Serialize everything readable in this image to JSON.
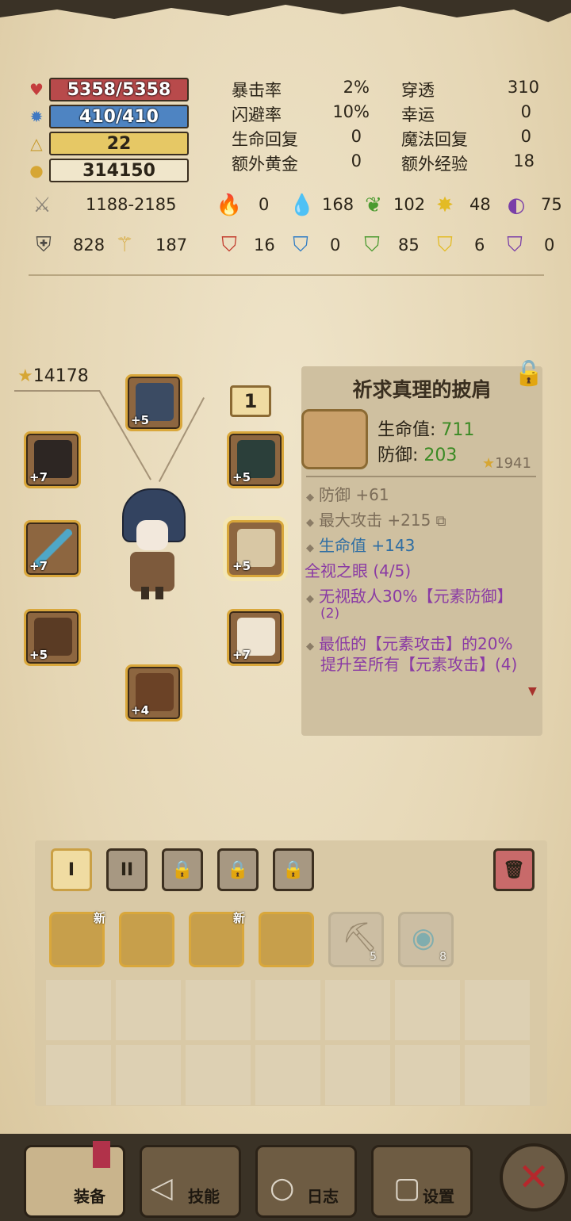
{
  "stats_bars": {
    "hp": "5358/5358",
    "mp": "410/410",
    "level": "22",
    "gold": "314150"
  },
  "stats_table": [
    {
      "label": "暴击率",
      "value": "2%"
    },
    {
      "label": "闪避率",
      "value": "10%"
    },
    {
      "label": "生命回复",
      "value": "0"
    },
    {
      "label": "额外黄金",
      "value": "0"
    },
    {
      "label": "穿透",
      "value": "310"
    },
    {
      "label": "幸运",
      "value": "0"
    },
    {
      "label": "魔法回复",
      "value": "0"
    },
    {
      "label": "额外经验",
      "value": "18"
    }
  ],
  "attack_row": {
    "damage": "1188-2185",
    "fire_atk": "0",
    "water_atk": "168",
    "nature_atk": "102",
    "light_atk": "48",
    "dark_atk": "75"
  },
  "defense_row": {
    "armor": "828",
    "magic": "187",
    "fire_def": "16",
    "water_def": "0",
    "nature_def": "85",
    "light_def": "6",
    "dark_def": "0"
  },
  "equipment": {
    "power_score": "14178",
    "page_number": "1",
    "slots": [
      {
        "name": "helmet",
        "plus": "+5"
      },
      {
        "name": "mask",
        "plus": "+7"
      },
      {
        "name": "sword",
        "plus": "+7"
      },
      {
        "name": "gloves",
        "plus": "+5"
      },
      {
        "name": "boots",
        "plus": "+4"
      },
      {
        "name": "amulet",
        "plus": "+5"
      },
      {
        "name": "shoulder",
        "plus": "+5"
      },
      {
        "name": "belt",
        "plus": "+7"
      }
    ]
  },
  "detail": {
    "title": "祈求真理的披肩",
    "hp_label": "生命值: ",
    "hp_value": "711",
    "def_label": "防御: ",
    "def_value": "203",
    "score": "1941",
    "line1": "防御 +61",
    "line2": "最大攻击 +215",
    "line3": "生命值 +143",
    "set_name": "全视之眼 (4/5)",
    "set1a": "无视敌人30%【元素防御】",
    "set1b": "(2)",
    "set2a": "最低的【元素攻击】的20%",
    "set2b": "提升至所有【元素攻击】(4)"
  },
  "inventory": {
    "tabs": [
      "I",
      "II",
      "",
      "",
      ""
    ],
    "new_badge": "新",
    "pickaxe_count": "5",
    "scroll_count": "8"
  },
  "nav": {
    "equip": "装备",
    "skills": "技能",
    "log": "日志",
    "settings": "设置"
  },
  "colors": {
    "hp": "#b84a4b",
    "mp": "#4e84c2",
    "level": "#e6c865",
    "frame": "#d9a73b",
    "set_purple": "#8a3aa4",
    "stat_green": "#3b8a24"
  }
}
